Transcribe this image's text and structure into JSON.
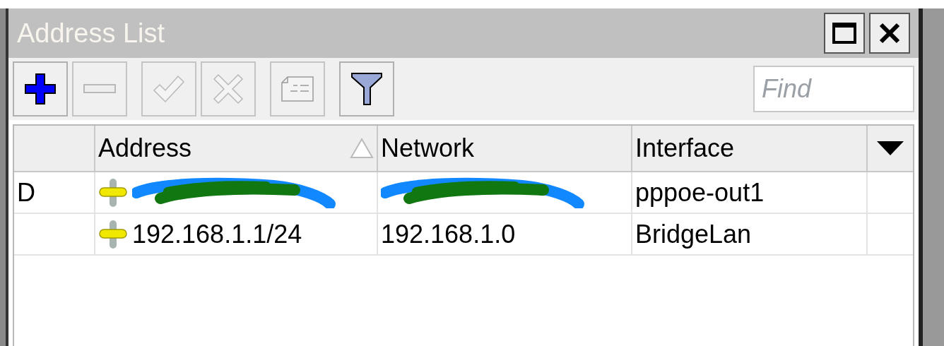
{
  "window": {
    "title": "Address List"
  },
  "toolbar": [
    {
      "kind": "add",
      "disabled": false
    },
    {
      "kind": "remove",
      "disabled": true
    },
    {
      "kind": "enable",
      "disabled": true
    },
    {
      "kind": "disable",
      "disabled": true
    },
    {
      "kind": "comment",
      "disabled": true
    },
    {
      "kind": "filter",
      "disabled": false
    }
  ],
  "search": {
    "placeholder": "Find"
  },
  "table": {
    "columns": [
      {
        "label": "Address",
        "sorted": true
      },
      {
        "label": "Network",
        "sorted": false
      },
      {
        "label": "Interface",
        "sorted": false
      }
    ],
    "rows": [
      {
        "flag": "D",
        "address": "",
        "network": "",
        "interface": "pppoe-out1",
        "redacted": true
      },
      {
        "flag": "",
        "address": "192.168.1.1/24",
        "network": "192.168.1.0",
        "interface": "BridgeLan",
        "redacted": false
      }
    ]
  }
}
